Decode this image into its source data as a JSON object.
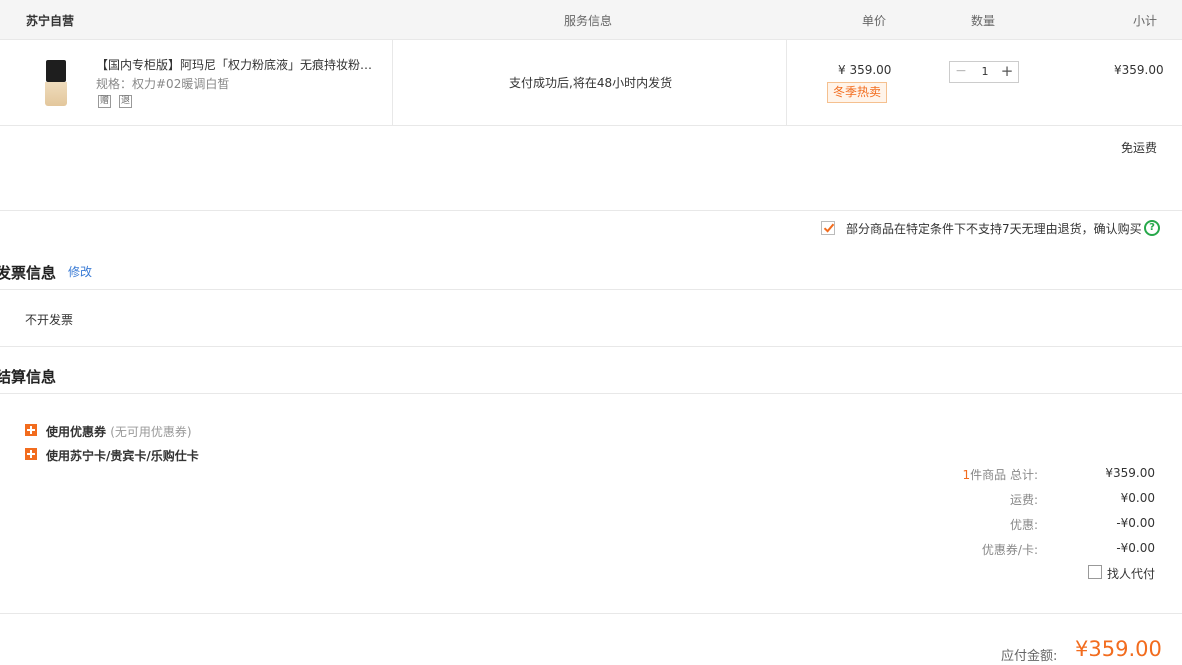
{
  "header": {
    "store": "苏宁自营",
    "service": "服务信息",
    "unit_price": "单价",
    "quantity": "数量",
    "subtotal": "小计"
  },
  "item": {
    "title": "【国内专柜版】阿玛尼「权力粉底液」无痕持妆粉底液",
    "spec": "规格：权力#02暖调白皙",
    "tag1": "赠",
    "tag2": "退",
    "service": "支付成功后,将在48小时内发货",
    "price": "¥ 359.00",
    "badge": "冬季热卖",
    "qty_minus": "−",
    "qty": "1",
    "qty_plus": "+",
    "subtotal": "¥359.00"
  },
  "shipping": "免运费",
  "confirm_text": "部分商品在特定条件下不支持7天无理由退货，确认购买",
  "help_icon": "?",
  "invoice": {
    "title": "发票信息",
    "edit": "修改",
    "value": "不开发票"
  },
  "settlement": {
    "title": "结算信息",
    "coupon_label": "使用优惠券",
    "coupon_note": "(无可用优惠券)",
    "card_label": "使用苏宁卡/贵宾卡/乐购仕卡"
  },
  "summary": {
    "count": "1",
    "count_suffix": "件商品 总计:",
    "total": "¥359.00",
    "freight_label": "运费:",
    "freight": "¥0.00",
    "discount_label": "优惠:",
    "discount": "-¥0.00",
    "coupon_label": "优惠券/卡:",
    "coupon": "-¥0.00",
    "proxy_pay": "找人代付"
  },
  "payable": {
    "label": "应付金额:",
    "value": "¥359.00"
  },
  "colors": {
    "accent": "#f26c1e",
    "link": "#3a7bd5",
    "help": "#27a84a"
  }
}
